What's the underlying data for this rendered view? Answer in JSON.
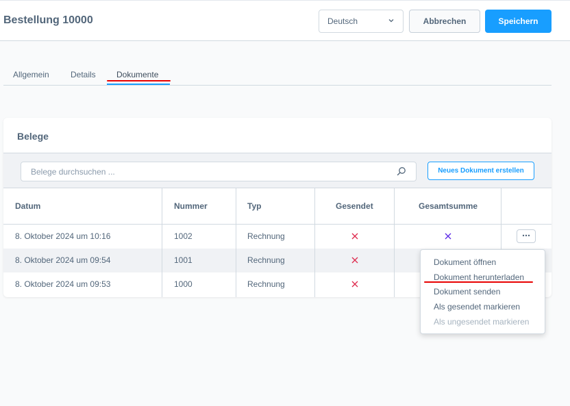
{
  "header": {
    "title": "Bestellung 10000",
    "language": "Deutsch",
    "cancel_label": "Abbrechen",
    "save_label": "Speichern"
  },
  "tabs": [
    {
      "label": "Allgemein"
    },
    {
      "label": "Details"
    },
    {
      "label": "Dokumente",
      "active": true
    }
  ],
  "card": {
    "title": "Belege",
    "search_placeholder": "Belege durchsuchen ...",
    "new_document_label": "Neues Dokument erstellen"
  },
  "table": {
    "columns": [
      "Datum",
      "Nummer",
      "Typ",
      "Gesendet",
      "Gesamtsumme"
    ],
    "rows": [
      {
        "datum": "8. Oktober 2024 um 10:16",
        "nummer": "1002",
        "typ": "Rechnung",
        "gesendet": "x-icon",
        "gesamtsumme": "x-icon"
      },
      {
        "datum": "8. Oktober 2024 um 09:54",
        "nummer": "1001",
        "typ": "Rechnung",
        "gesendet": "x-icon",
        "gesamtsumme": ""
      },
      {
        "datum": "8. Oktober 2024 um 09:53",
        "nummer": "1000",
        "typ": "Rechnung",
        "gesendet": "x-icon",
        "gesamtsumme": ""
      }
    ]
  },
  "context_menu": {
    "items": [
      {
        "label": "Dokument öffnen"
      },
      {
        "label": "Dokument herunterladen"
      },
      {
        "label": "Dokument senden"
      },
      {
        "label": "Als gesendet markieren"
      },
      {
        "label": "Als ungesendet markieren",
        "disabled": true
      }
    ]
  },
  "colors": {
    "accent": "#189eff",
    "annotation": "#e80000",
    "x_red": "#de294c",
    "x_purple": "#5a28e6"
  }
}
